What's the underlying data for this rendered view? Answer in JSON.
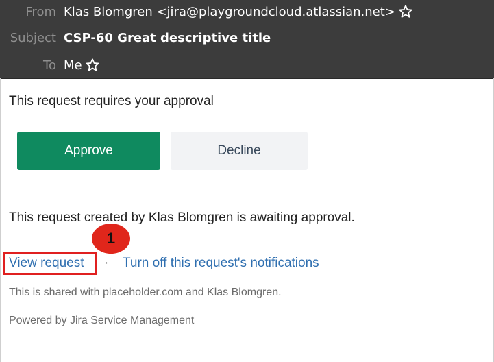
{
  "header": {
    "from_label": "From",
    "from_value": "Klas Blomgren <jira@playgroundcloud.atlassian.net>",
    "subject_label": "Subject",
    "subject_value": "CSP-60 Great descriptive title",
    "to_label": "To",
    "to_value": "Me"
  },
  "email": {
    "intro": "This request requires your approval",
    "approve_label": "Approve",
    "decline_label": "Decline",
    "awaiting_text": "This request created by Klas Blomgren is awaiting approval.",
    "view_request_link": "View request",
    "separator": "·",
    "notifications_link": "Turn off this request's notifications",
    "shared_text": "This is shared with placeholder.com and Klas Blomgren.",
    "powered_text": "Powered by Jira Service Management"
  },
  "annotation": {
    "badge_number": "1",
    "highlight_color": "#e02020"
  },
  "icons": {
    "from_star": "star-outline-icon",
    "to_star": "star-outline-icon"
  },
  "colors": {
    "header_bg": "#3c3c3c",
    "approve_bg": "#0f8a5f",
    "decline_bg": "#f2f3f5",
    "link": "#2f6fb0"
  }
}
